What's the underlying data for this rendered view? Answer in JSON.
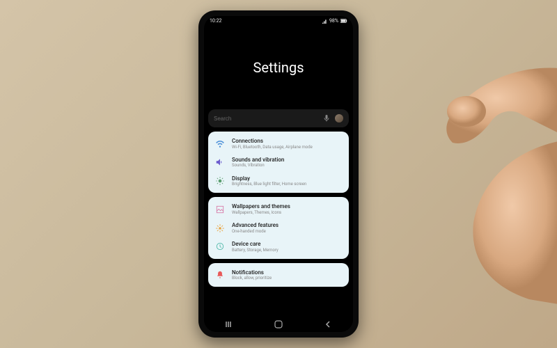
{
  "status": {
    "time": "10:22",
    "battery": "98%"
  },
  "header": {
    "title": "Settings"
  },
  "search": {
    "placeholder": "Search"
  },
  "groups": [
    {
      "items": [
        {
          "icon": "wifi",
          "color": "#4a8fd8",
          "title": "Connections",
          "sub": "Wi-Fi, Bluetooth, Data usage, Airplane mode"
        },
        {
          "icon": "sound",
          "color": "#6a5acd",
          "title": "Sounds and vibration",
          "sub": "Sounds, Vibration"
        },
        {
          "icon": "display",
          "color": "#5a9e6f",
          "title": "Display",
          "sub": "Brightness, Blue light filter, Home screen"
        }
      ]
    },
    {
      "items": [
        {
          "icon": "wallpaper",
          "color": "#d87ba8",
          "title": "Wallpapers and themes",
          "sub": "Wallpapers, Themes, Icons"
        },
        {
          "icon": "advanced",
          "color": "#e8a33d",
          "title": "Advanced features",
          "sub": "One-handed mode"
        },
        {
          "icon": "care",
          "color": "#4db8a8",
          "title": "Device care",
          "sub": "Battery, Storage, Memory"
        }
      ]
    },
    {
      "items": [
        {
          "icon": "notif",
          "color": "#e85a5a",
          "title": "Notifications",
          "sub": "Block, allow, prioritize"
        }
      ]
    }
  ],
  "icons": {
    "wifi": "wifi-icon",
    "sound": "sound-icon",
    "display": "display-icon",
    "wallpaper": "wallpaper-icon",
    "advanced": "advanced-icon",
    "care": "device-care-icon",
    "notif": "notifications-icon",
    "mic": "mic-icon",
    "back": "back-icon",
    "home": "home-icon",
    "recent": "recent-icon"
  }
}
